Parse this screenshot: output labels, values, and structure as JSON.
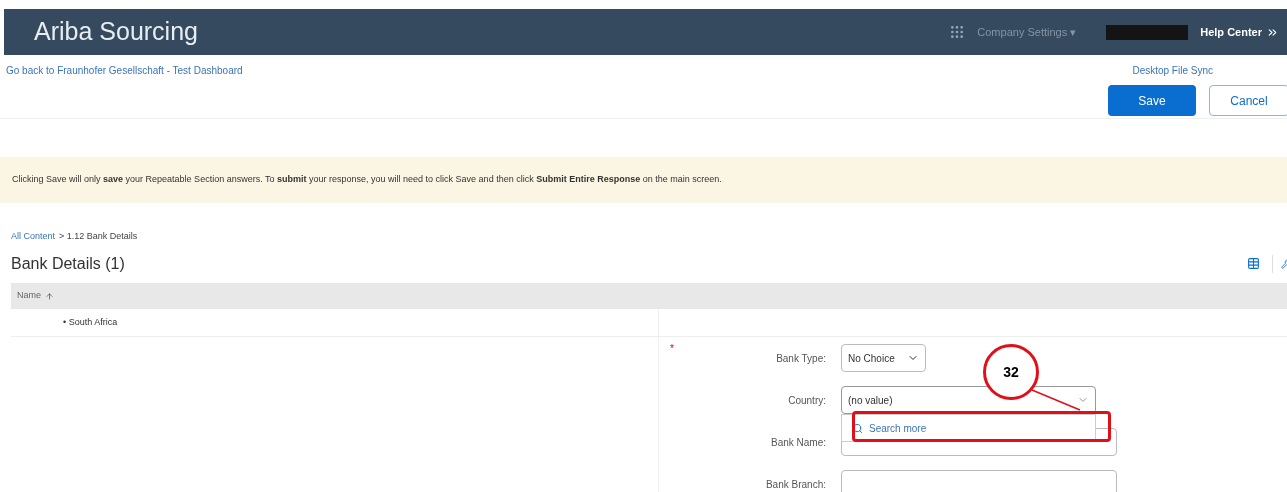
{
  "header": {
    "title": "Ariba Sourcing",
    "menu": "Company Settings ▾",
    "help": "Help Center"
  },
  "links": {
    "back": "Go back to Fraunhofer Gesellschaft - Test Dashboard",
    "sync": "Desktop File Sync"
  },
  "buttons": [
    {
      "label": "Save",
      "kind": "primary"
    },
    {
      "label": "Cancel",
      "kind": "secondary"
    }
  ],
  "banner": "Clicking Save will only **save** your Repeatable Section answers. To **submit** your response, you will need to click Save and then click **Submit Entire Response** on the main screen.",
  "breadcrumb": {
    "link": "All Content",
    "rest": "> 1.12 Bank Details"
  },
  "section_title": "Bank Details (1)",
  "table": {
    "columns": [
      "Name"
    ],
    "rows": [
      "• South Africa"
    ]
  },
  "form": {
    "required_mark": "*",
    "fields": [
      {
        "label": "Bank Type:",
        "kind": "select",
        "value": "No Choice"
      },
      {
        "label": "Country:",
        "kind": "combo",
        "value": "(no value)",
        "expanded": true
      },
      {
        "label": "Bank Name:",
        "kind": "text"
      },
      {
        "label": "Bank Branch:",
        "kind": "text"
      }
    ]
  },
  "dropdown": {
    "option": "Search more"
  },
  "annotation": {
    "number": "32"
  }
}
